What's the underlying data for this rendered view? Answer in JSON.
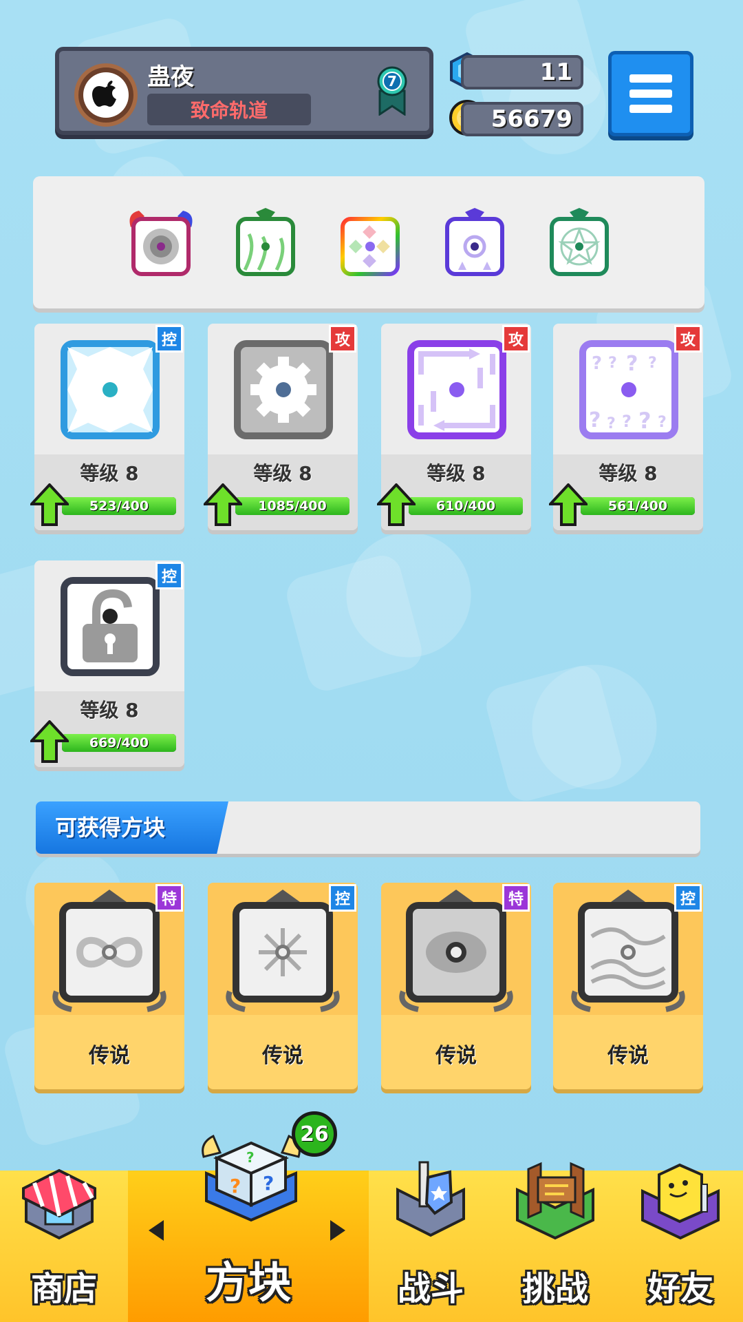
{
  "player": {
    "name": "蛊夜",
    "title": "致命轨道",
    "rank": "7"
  },
  "currency": {
    "gems": "11",
    "coins": "56679"
  },
  "deck": {
    "slots": [
      "tornado-die-icon",
      "vine-die-icon",
      "rainbow-die-icon",
      "orbit-die-icon",
      "pentagram-die-icon"
    ]
  },
  "cards": [
    {
      "name": "ice-die",
      "tag": "控",
      "tag_color": "#1e86e6",
      "level": "等级 8",
      "xp": "523/400",
      "border": "#2f9be0",
      "pip": "#2ab0c4"
    },
    {
      "name": "gear-die",
      "tag": "攻",
      "tag_color": "#e53a3a",
      "level": "等级 8",
      "xp": "1085/400",
      "border": "#6b6b6b",
      "pip": "#4f6e96"
    },
    {
      "name": "path-die",
      "tag": "攻",
      "tag_color": "#e53a3a",
      "level": "等级 8",
      "xp": "610/400",
      "border": "#8a3fe8",
      "pip": "#8a5cf0"
    },
    {
      "name": "mystery-die",
      "tag": "攻",
      "tag_color": "#e53a3a",
      "level": "等级 8",
      "xp": "561/400",
      "border": "#9b7cf0",
      "pip": "#8a5cf0"
    },
    {
      "name": "lock-die",
      "tag": "控",
      "tag_color": "#1e86e6",
      "level": "等级 8",
      "xp": "669/400",
      "border": "#3a3f4d",
      "pip": "#222"
    }
  ],
  "available": {
    "header": "可获得方块",
    "items": [
      {
        "name": "infinity-legend-die",
        "tag": "特",
        "tag_color": "#9b36d8",
        "rarity": "传说"
      },
      {
        "name": "snowflake-legend-die",
        "tag": "控",
        "tag_color": "#1e86e6",
        "rarity": "传说"
      },
      {
        "name": "vortex-legend-die",
        "tag": "特",
        "tag_color": "#9b36d8",
        "rarity": "传说"
      },
      {
        "name": "wave-legend-die",
        "tag": "控",
        "tag_color": "#1e86e6",
        "rarity": "传说"
      }
    ]
  },
  "nav": {
    "shop": "商店",
    "dice": "方块",
    "dice_badge": "26",
    "battle": "战斗",
    "challenge": "挑战",
    "friends": "好友"
  },
  "colors": {
    "background": "#9fdcf2",
    "nav": "#ffc42a",
    "accent_blue": "#1f8ff0"
  }
}
